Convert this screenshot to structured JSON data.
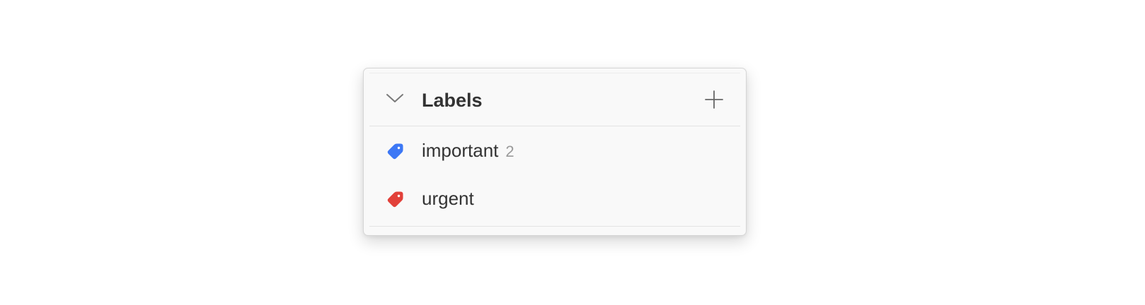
{
  "labels_panel": {
    "title": "Labels",
    "collapse_icon": "chevron-down-icon",
    "add_icon": "plus-icon",
    "items": [
      {
        "name": "important",
        "count": "2",
        "color": "#3d78f5",
        "icon": "tag-icon"
      },
      {
        "name": "urgent",
        "count": "",
        "color": "#e2413a",
        "icon": "tag-icon"
      }
    ]
  }
}
